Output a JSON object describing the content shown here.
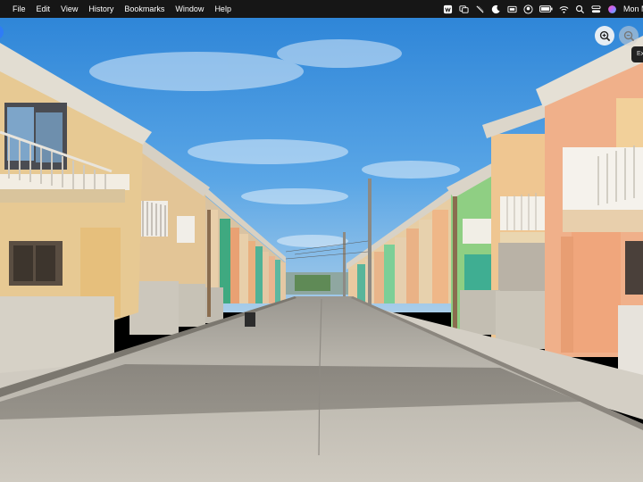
{
  "menubar": {
    "items": [
      "File",
      "Edit",
      "View",
      "History",
      "Bookmarks",
      "Window",
      "Help"
    ],
    "status_icons": [
      "word-icon",
      "screen-mirror-icon",
      "slash-icon",
      "moon-icon",
      "display-icon",
      "user-circle-icon",
      "battery-icon",
      "wifi-icon",
      "search-icon",
      "control-center-icon",
      "siri-icon"
    ],
    "clock": "Mon M"
  },
  "viewer": {
    "zoom_in_icon": "zoom-in-icon",
    "zoom_out_icon": "zoom-out-icon",
    "tooltip": "Ex",
    "photo_description_icon": "townhouse-street-photo"
  }
}
